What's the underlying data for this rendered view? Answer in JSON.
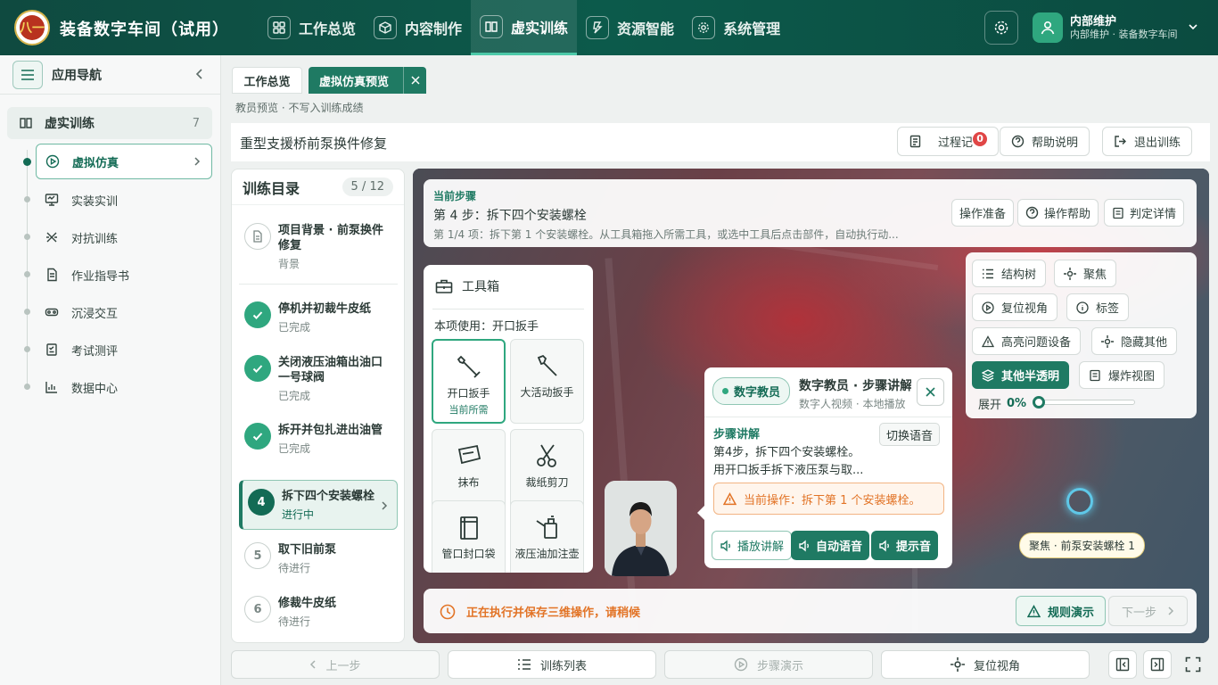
{
  "header": {
    "logo_text": "八一",
    "app_title": "装备数字车间（试用）",
    "nav": [
      {
        "label": "工作总览"
      },
      {
        "label": "内容制作"
      },
      {
        "label": "虚实训练"
      },
      {
        "label": "资源智能"
      },
      {
        "label": "系统管理"
      }
    ],
    "user": {
      "name": "内部维护",
      "sub": "内部维护 · 装备数字车间"
    }
  },
  "sidebar": {
    "title": "应用导航",
    "group": {
      "label": "虚实训练",
      "count": "7"
    },
    "items": [
      {
        "label": "虚拟仿真"
      },
      {
        "label": "实装实训"
      },
      {
        "label": "对抗训练"
      },
      {
        "label": "作业指导书"
      },
      {
        "label": "沉浸交互"
      },
      {
        "label": "考试测评"
      },
      {
        "label": "数据中心"
      }
    ]
  },
  "tabs": [
    {
      "label": "工作总览"
    },
    {
      "label": "虚拟仿真预览"
    }
  ],
  "hint": "教员预览 · 不写入训练成绩",
  "page": {
    "title": "重型支援桥前泵换件修复",
    "buttons": {
      "record": "过程记",
      "record_badge": "0",
      "help": "帮助说明",
      "exit": "退出训练"
    }
  },
  "catalog": {
    "title": "训练目录",
    "count": "5 / 12",
    "steps": [
      {
        "no": "",
        "title": "项目背景 · 前泵换件修复",
        "status": "背景"
      },
      {
        "no": "",
        "title": "停机并初裁牛皮纸",
        "status": "已完成"
      },
      {
        "no": "",
        "title": "关闭液压油箱出油口一号球阀",
        "status": "已完成"
      },
      {
        "no": "",
        "title": "拆开并包扎进出油管",
        "status": "已完成"
      },
      {
        "no": "4",
        "title": "拆下四个安装螺栓",
        "status": "进行中"
      },
      {
        "no": "5",
        "title": "取下旧前泵",
        "status": "待进行"
      },
      {
        "no": "6",
        "title": "修裁牛皮纸",
        "status": "待进行"
      }
    ]
  },
  "current_step": {
    "label": "当前步骤",
    "title": "第 4 步：拆下四个安装螺栓",
    "desc": "第 1/4 项：拆下第 1 个安装螺栓。从工具箱拖入所需工具，或选中工具后点击部件，自动执行动...",
    "buttons": [
      "操作准备",
      "操作帮助",
      "判定详情"
    ]
  },
  "toolbox": {
    "title": "工具箱",
    "use": "本项使用：开口扳手",
    "tools": [
      {
        "name": "开口扳手",
        "tag": "当前所需"
      },
      {
        "name": "大活动扳手",
        "tag": ""
      },
      {
        "name": "抹布",
        "tag": ""
      },
      {
        "name": "裁纸剪刀",
        "tag": ""
      },
      {
        "name": "管口封口袋",
        "tag": ""
      },
      {
        "name": "液压油加注壶",
        "tag": ""
      }
    ]
  },
  "view_panel": {
    "buttons": [
      "结构树",
      "聚焦",
      "复位视角",
      "标签",
      "高亮问题设备",
      "隐藏其他",
      "其他半透明",
      "爆炸视图"
    ],
    "spread_label": "展开",
    "spread_value": "0%",
    "spread_fraction": 0
  },
  "teacher": {
    "pill": "数字教员",
    "name": "数字教员 · 步骤讲解",
    "sub": "数字人视频 · 本地播放",
    "section": "步骤讲解",
    "switch": "切换语音",
    "text_line1": "第4步，拆下四个安装螺栓。",
    "text_line2": "用开口扳手拆下液压泵与取...",
    "warning": "当前操作：拆下第 1 个安装螺栓。",
    "buttons": [
      "播放讲解",
      "自动语音",
      "提示音"
    ]
  },
  "focus_tip": "聚焦 · 前泵安装螺栓 1",
  "status": {
    "message": "正在执行并保存三维操作，请稍候",
    "rule": "规则演示",
    "next": "下一步"
  },
  "bottom": {
    "prev": "上一步",
    "list": "训练列表",
    "demo": "步骤演示",
    "reset": "复位视角"
  },
  "colors": {
    "primary": "#1f7a63",
    "header": "#0f4a40",
    "warning": "#e27427",
    "badge": "#e04646"
  }
}
